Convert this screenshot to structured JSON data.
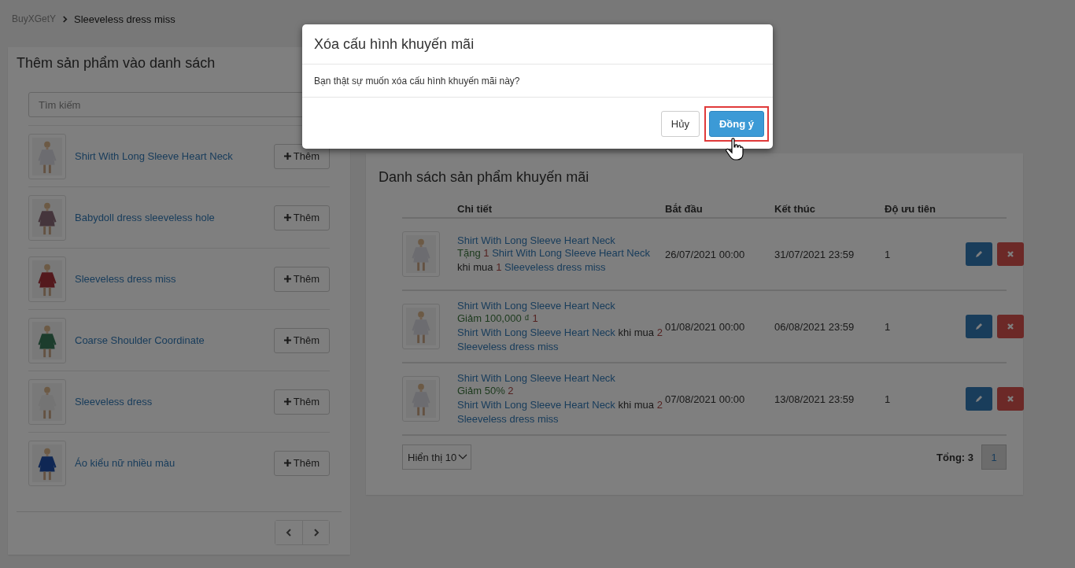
{
  "breadcrumb": {
    "parent": "BuyXGetY",
    "current": "Sleeveless dress miss"
  },
  "add_panel": {
    "title": "Thêm sản phẩm vào danh sách",
    "search": {
      "placeholder": "Tìm kiếm"
    },
    "products": [
      {
        "name": "Shirt With Long Sleeve Heart Neck",
        "button": "Thêm"
      },
      {
        "name": "Babydoll dress sleeveless hole",
        "button": "Thêm"
      },
      {
        "name": "Sleeveless dress miss",
        "button": "Thêm"
      },
      {
        "name": "Coarse Shoulder Coordinate",
        "button": "Thêm"
      },
      {
        "name": "Sleeveless dress",
        "button": "Thêm"
      },
      {
        "name": "Áo kiểu nữ nhiều màu",
        "button": "Thêm"
      }
    ]
  },
  "promo_panel": {
    "title": "Danh sách sản phẩm khuyến mãi",
    "columns": [
      "Chi tiết",
      "Bắt đầu",
      "Kết thúc",
      "Độ ưu tiên"
    ],
    "rows": [
      {
        "product": "Shirt With Long Sleeve Heart Neck",
        "description": [
          {
            "kind": "action",
            "text": "Tặng"
          },
          {
            "kind": "qty",
            "text": "1"
          },
          {
            "kind": "link",
            "text": "Shirt With Long Sleeve Heart Neck"
          },
          {
            "kind": "text",
            "text": "khi mua"
          },
          {
            "kind": "qty",
            "text": "1"
          },
          {
            "kind": "link",
            "text": "Sleeveless dress miss"
          }
        ],
        "start": "26/07/2021 00:00",
        "end": "31/07/2021 23:59",
        "priority": "1"
      },
      {
        "product": "Shirt With Long Sleeve Heart Neck",
        "description": [
          {
            "kind": "action",
            "text": "Giảm 100,000 ₫"
          },
          {
            "kind": "qty",
            "text": "1"
          },
          {
            "kind": "link",
            "text": "Shirt With Long Sleeve Heart Neck"
          },
          {
            "kind": "text",
            "text": "khi mua"
          },
          {
            "kind": "qty",
            "text": "2"
          },
          {
            "kind": "link",
            "text": "Sleeveless dress miss"
          }
        ],
        "start": "01/08/2021 00:00",
        "end": "06/08/2021 23:59",
        "priority": "1"
      },
      {
        "product": "Shirt With Long Sleeve Heart Neck",
        "description": [
          {
            "kind": "action",
            "text": "Giảm 50%"
          },
          {
            "kind": "qty",
            "text": "2"
          },
          {
            "kind": "link",
            "text": "Shirt With Long Sleeve Heart Neck"
          },
          {
            "kind": "text",
            "text": "khi mua"
          },
          {
            "kind": "qty",
            "text": "2"
          },
          {
            "kind": "link",
            "text": "Sleeveless dress miss"
          }
        ],
        "start": "07/08/2021 00:00",
        "end": "13/08/2021 23:59",
        "priority": "1"
      }
    ],
    "page_size": "Hiển thị 10",
    "total": "Tổng: 3",
    "pages": [
      {
        "label": "1",
        "selected": true
      }
    ]
  },
  "dialog": {
    "title": "Xóa cấu hình khuyến mãi",
    "message": "Bạn thật sự muốn xóa cấu hình khuyến mãi này?",
    "buttons": [
      {
        "label": "Hủy",
        "kind": "default"
      },
      {
        "label": "Đồng ý",
        "kind": "primary",
        "highlighted": true
      }
    ]
  }
}
